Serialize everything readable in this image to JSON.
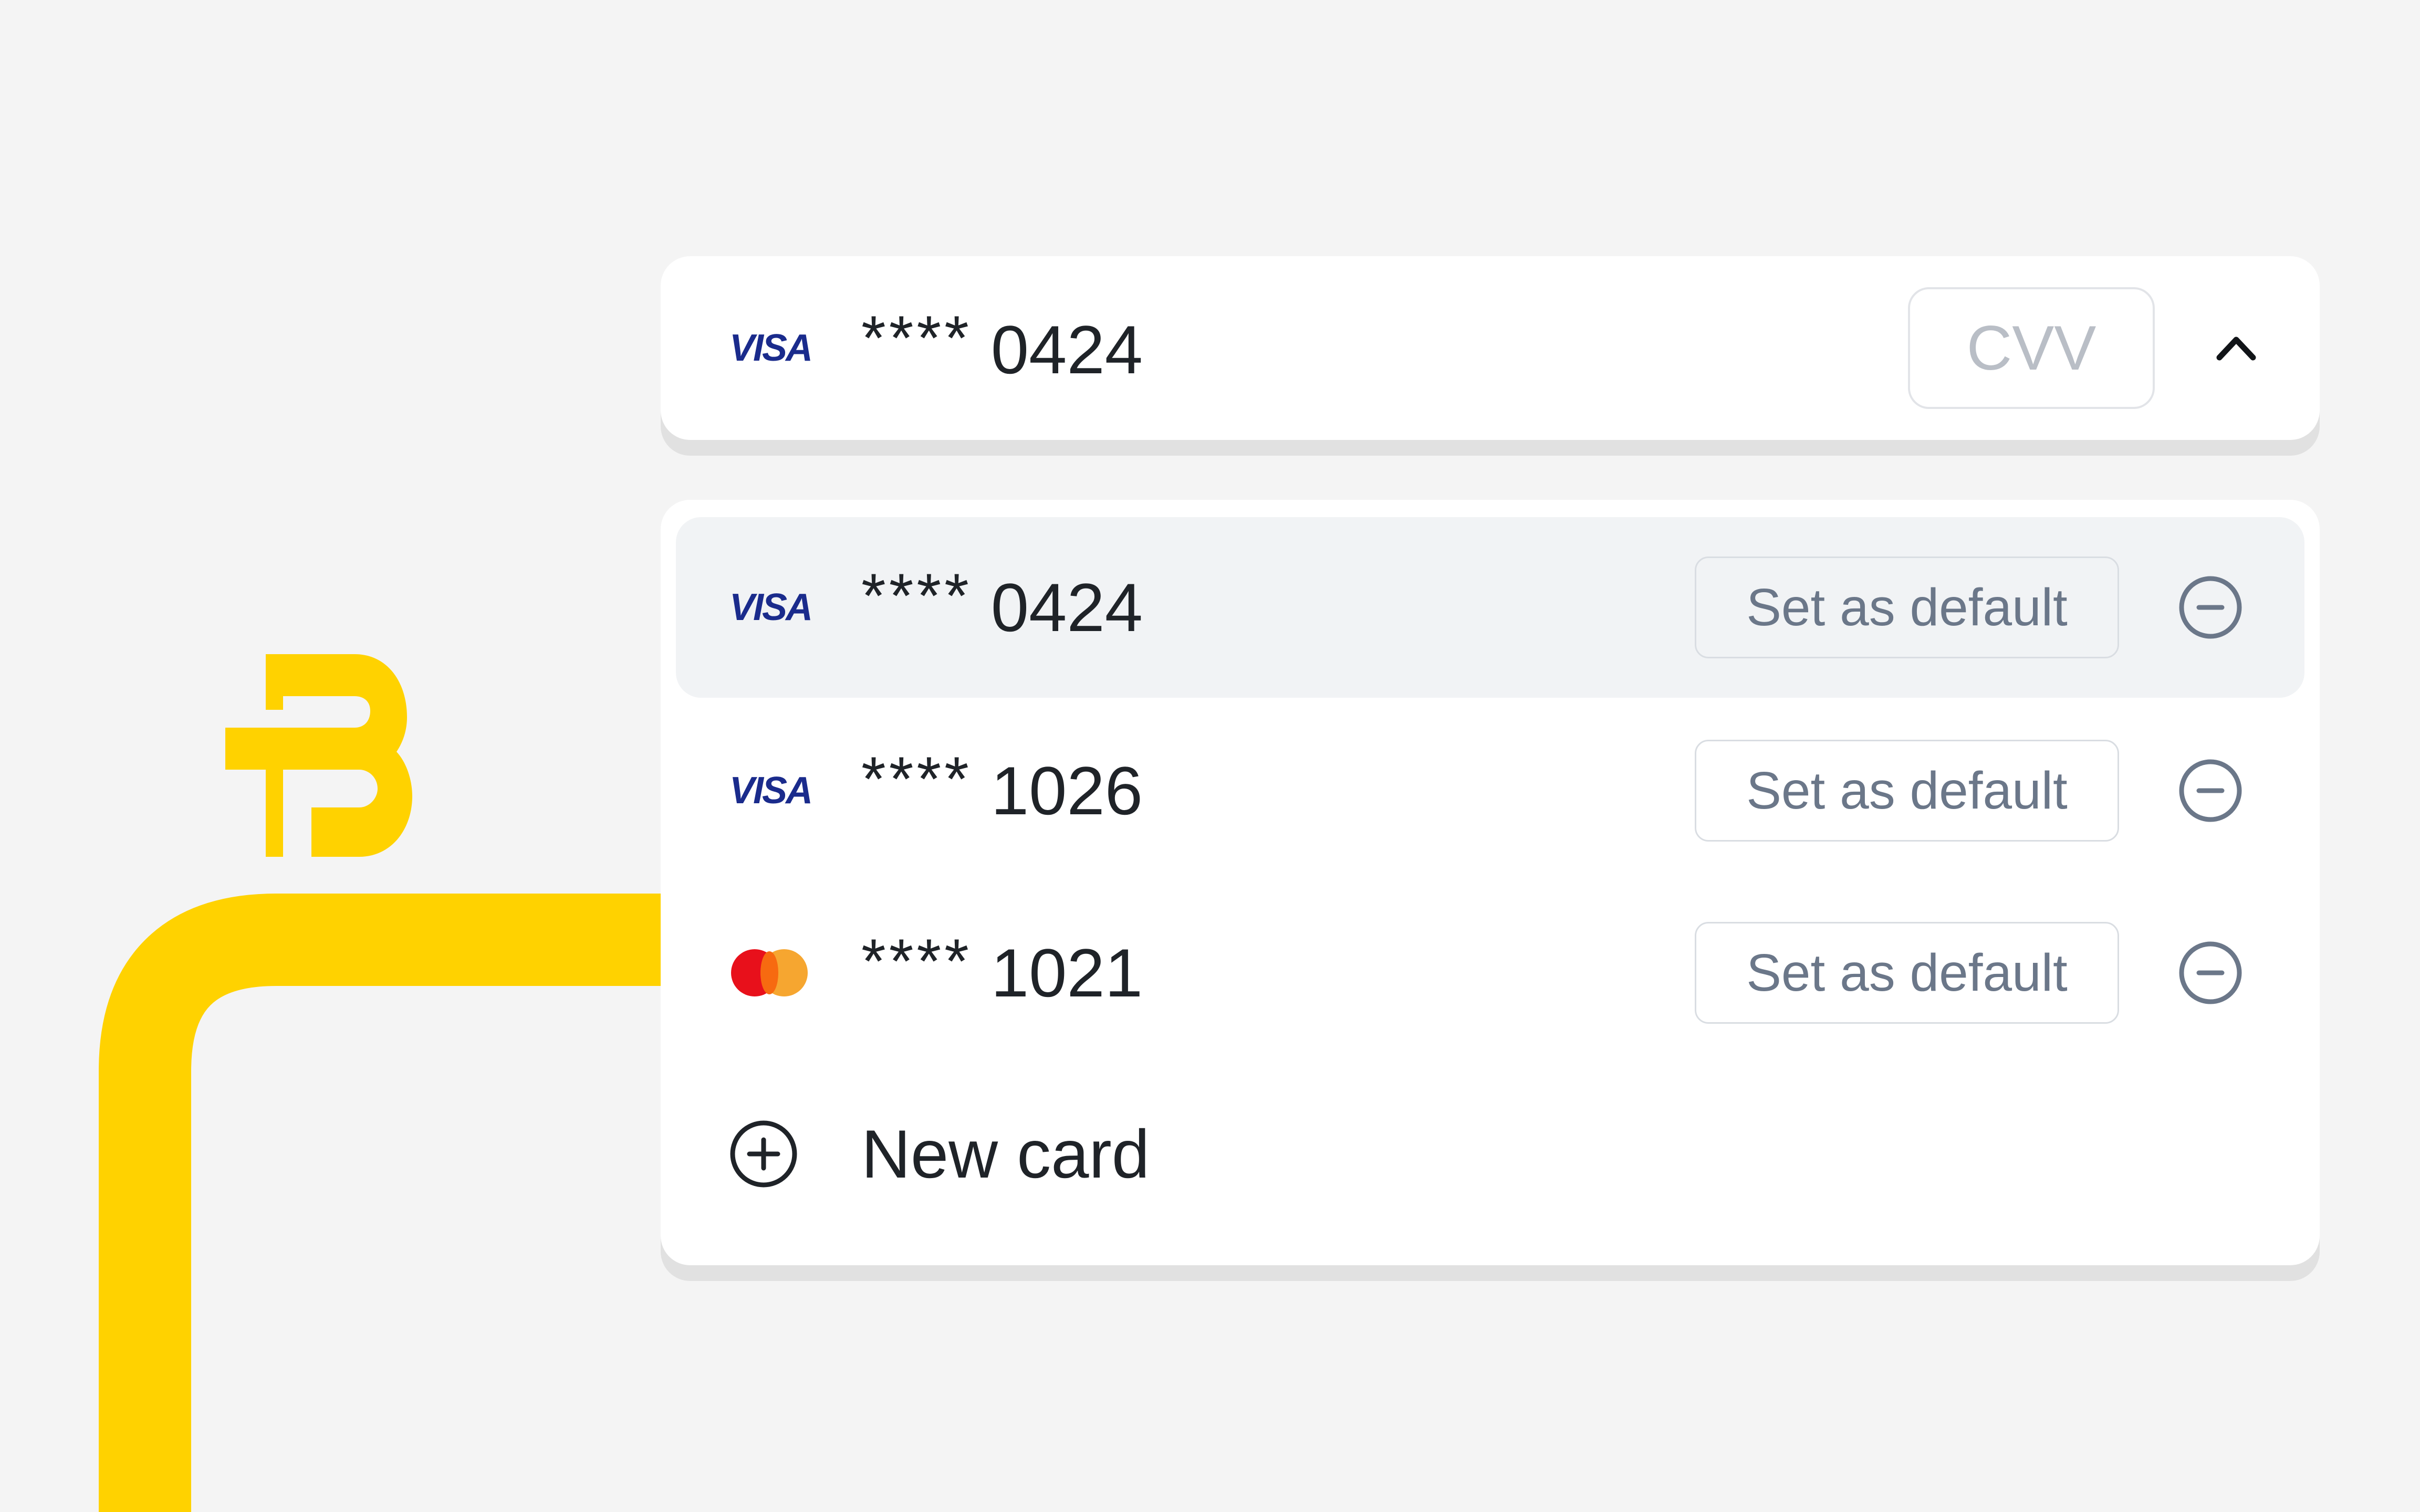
{
  "colors": {
    "background": "#f4f4f4",
    "brand_yellow": "#ffd200",
    "card_bg": "#ffffff",
    "card_shadow": "#e1e1e1",
    "highlight_row": "#f1f3f5",
    "text_primary": "#1f2328",
    "text_muted": "#6b7789",
    "placeholder": "#b9bec6",
    "visa_blue": "#1a2b8c",
    "mastercard_red": "#e8101b",
    "mastercard_orange": "#f59e1e"
  },
  "selected_card": {
    "brand": "VISA",
    "mask": "****",
    "last4": "0424",
    "cvv_placeholder": "CVV",
    "toggle_icon": "chevron-up-icon"
  },
  "card_list": {
    "items": [
      {
        "brand": "VISA",
        "brand_icon": "visa-logo-icon",
        "mask": "****",
        "last4": "0424",
        "highlighted": true,
        "action_label": "Set as default",
        "remove_icon": "minus-circle-icon"
      },
      {
        "brand": "VISA",
        "brand_icon": "visa-logo-icon",
        "mask": "****",
        "last4": "1026",
        "highlighted": false,
        "action_label": "Set as default",
        "remove_icon": "minus-circle-icon"
      },
      {
        "brand": "Mastercard",
        "brand_icon": "mastercard-logo-icon",
        "mask": "****",
        "last4": "1021",
        "highlighted": false,
        "action_label": "Set as default",
        "remove_icon": "minus-circle-icon"
      }
    ],
    "new_card": {
      "label": "New card",
      "icon": "plus-circle-icon"
    }
  },
  "brand_logo": {
    "icon": "brand-b-logo-icon"
  }
}
